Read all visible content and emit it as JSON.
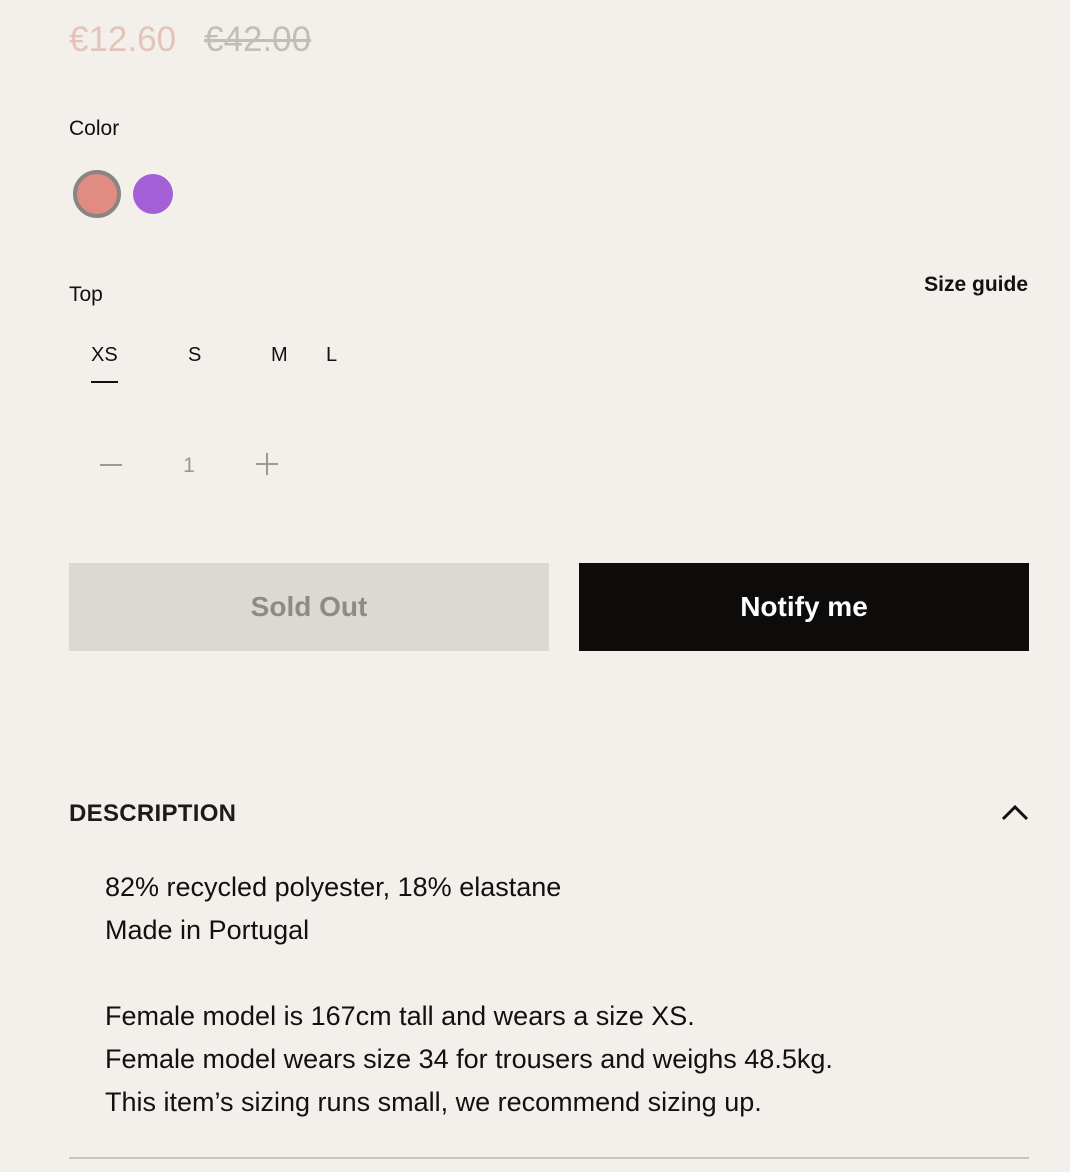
{
  "pricing": {
    "sale_price": "€12.60",
    "original_price": "€42.00"
  },
  "color": {
    "label": "Color",
    "swatches": [
      {
        "name": "coral",
        "hex": "#e08c83",
        "selected": true
      },
      {
        "name": "purple",
        "hex": "#a45fd6",
        "selected": false
      }
    ]
  },
  "size": {
    "label": "Top",
    "guide_label": "Size guide",
    "options": [
      "XS",
      "S",
      "M",
      "L"
    ],
    "selected": "XS"
  },
  "quantity": {
    "value": "1"
  },
  "actions": {
    "sold_out_label": "Sold Out",
    "notify_label": "Notify me"
  },
  "description": {
    "heading": "DESCRIPTION",
    "lines": [
      "82% recycled polyester, 18% elastane",
      "Made in Portugal"
    ],
    "model_lines": [
      "Female model is 167cm tall and wears a size XS.",
      "Female model wears size 34 for trousers and weighs 48.5kg.",
      "This item’s sizing runs small, we recommend sizing up."
    ]
  },
  "colors": {
    "background": "#f3efeb",
    "notify_bg": "#0d0c0b",
    "sold_out_bg": "#dcd9d5",
    "sale_price": "#e4c3b8"
  }
}
